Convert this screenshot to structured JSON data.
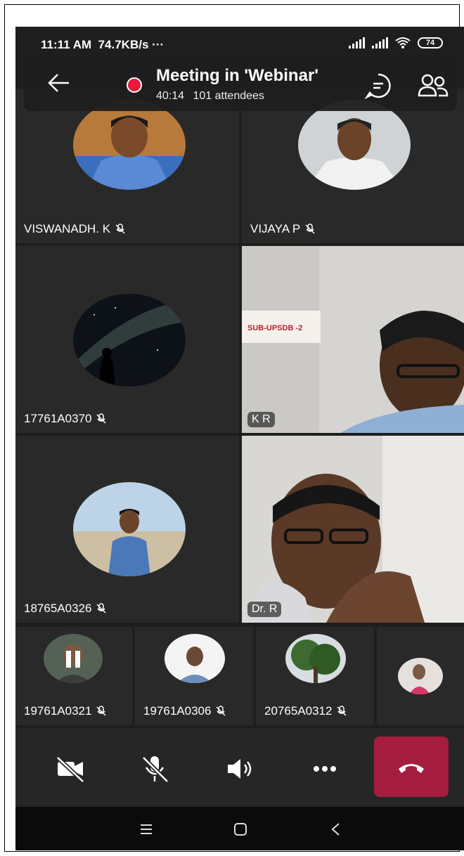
{
  "status_bar": {
    "time": "11:11 AM",
    "speed": "74.7KB/s",
    "more": "···",
    "battery": "74"
  },
  "header": {
    "title": "Meeting in 'Webinar'",
    "duration": "40:14",
    "attendees": "101 attendees",
    "back_icon": "arrow-left-icon",
    "chat_icon": "chat-icon",
    "people_icon": "people-icon"
  },
  "tiles": [
    {
      "name": "VISWANADH. K",
      "muted": true
    },
    {
      "name": "VIJAYA P",
      "muted": true
    },
    {
      "name": "17761A0370",
      "muted": true
    },
    {
      "name": "K R",
      "muted": false
    },
    {
      "name": "18765A0326",
      "muted": true
    },
    {
      "name": "Dr. R",
      "muted": false
    }
  ],
  "small_tiles": [
    {
      "name": "19761A0321",
      "muted": true
    },
    {
      "name": "19761A0306",
      "muted": true
    },
    {
      "name": "20765A0312",
      "muted": true
    },
    {
      "name": "",
      "muted": false
    }
  ],
  "controls": {
    "camera_icon": "camera-off-icon",
    "mic_icon": "mic-off-icon",
    "speaker_icon": "speaker-icon",
    "more_icon": "more-icon",
    "hangup_icon": "hangup-icon"
  },
  "colors": {
    "record": "#e8193c",
    "hangup": "#a51d3e",
    "background": "#1e1e1e"
  }
}
